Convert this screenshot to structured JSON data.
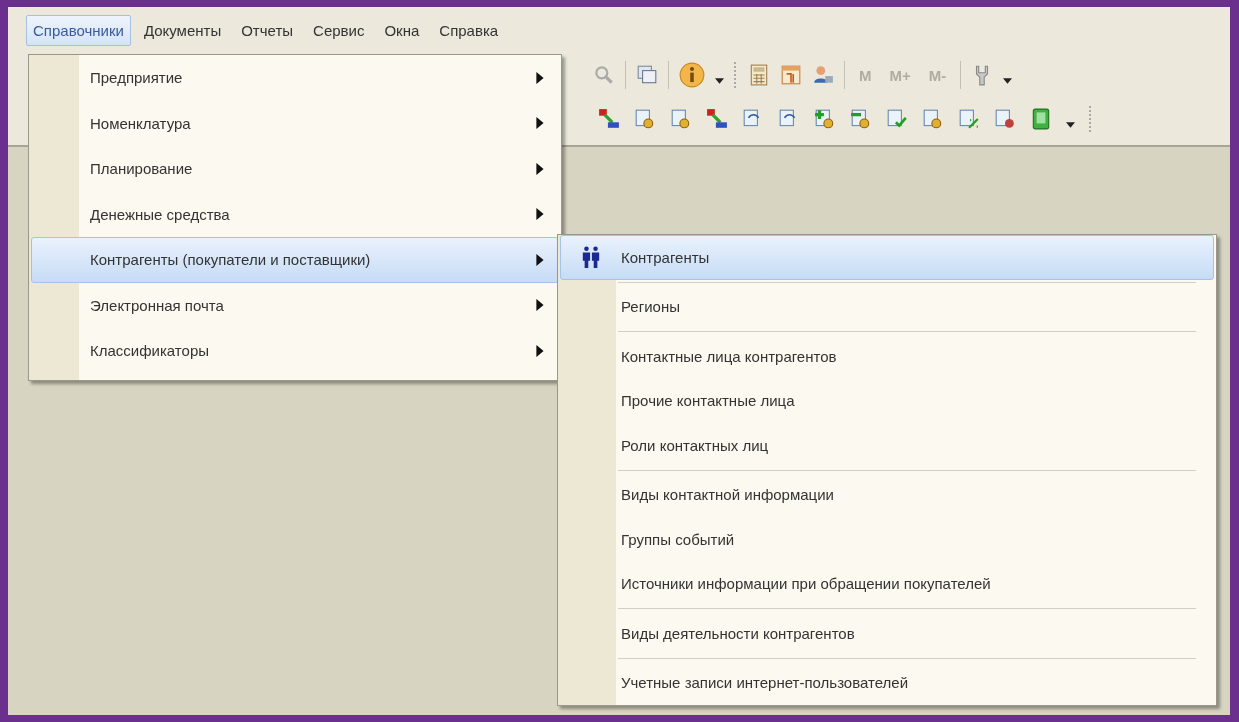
{
  "menu_bar": [
    {
      "label": "Справочники",
      "selected": true
    },
    {
      "label": "Документы",
      "selected": false
    },
    {
      "label": "Отчеты",
      "selected": false
    },
    {
      "label": "Сервис",
      "selected": false
    },
    {
      "label": "Окна",
      "selected": false
    },
    {
      "label": "Справка",
      "selected": false
    }
  ],
  "toolbar": {
    "memory_buttons": [
      {
        "label": "M",
        "disabled": true
      },
      {
        "label": "M+",
        "disabled": true
      },
      {
        "label": "M-",
        "disabled": true
      }
    ]
  },
  "dropdown": {
    "items": [
      {
        "label": "Предприятие",
        "selected": false
      },
      {
        "label": "Номенклатура",
        "selected": false
      },
      {
        "label": "Планирование",
        "selected": false
      },
      {
        "label": "Денежные средства",
        "selected": false
      },
      {
        "label": "Контрагенты (покупатели и поставщики)",
        "selected": true
      },
      {
        "label": "Электронная почта",
        "selected": false
      },
      {
        "label": "Классификаторы",
        "selected": false
      }
    ]
  },
  "submenu": {
    "groups": [
      {
        "items": [
          {
            "label": "Контрагенты",
            "selected": true,
            "has_icon": true
          }
        ]
      },
      {
        "items": [
          {
            "label": "Регионы",
            "selected": false,
            "has_icon": false
          }
        ]
      },
      {
        "items": [
          {
            "label": "Контактные лица контрагентов",
            "selected": false,
            "has_icon": false
          },
          {
            "label": "Прочие контактные лица",
            "selected": false,
            "has_icon": false
          },
          {
            "label": "Роли контактных лиц",
            "selected": false,
            "has_icon": false
          }
        ]
      },
      {
        "items": [
          {
            "label": "Виды контактной информации",
            "selected": false,
            "has_icon": false
          },
          {
            "label": "Группы событий",
            "selected": false,
            "has_icon": false
          },
          {
            "label": "Источники информации при обращении покупателей",
            "selected": false,
            "has_icon": false
          }
        ]
      },
      {
        "items": [
          {
            "label": "Виды деятельности контрагентов",
            "selected": false,
            "has_icon": false
          }
        ]
      },
      {
        "items": [
          {
            "label": "Учетные записи интернет-пользователей",
            "selected": false,
            "has_icon": false
          }
        ]
      }
    ]
  }
}
